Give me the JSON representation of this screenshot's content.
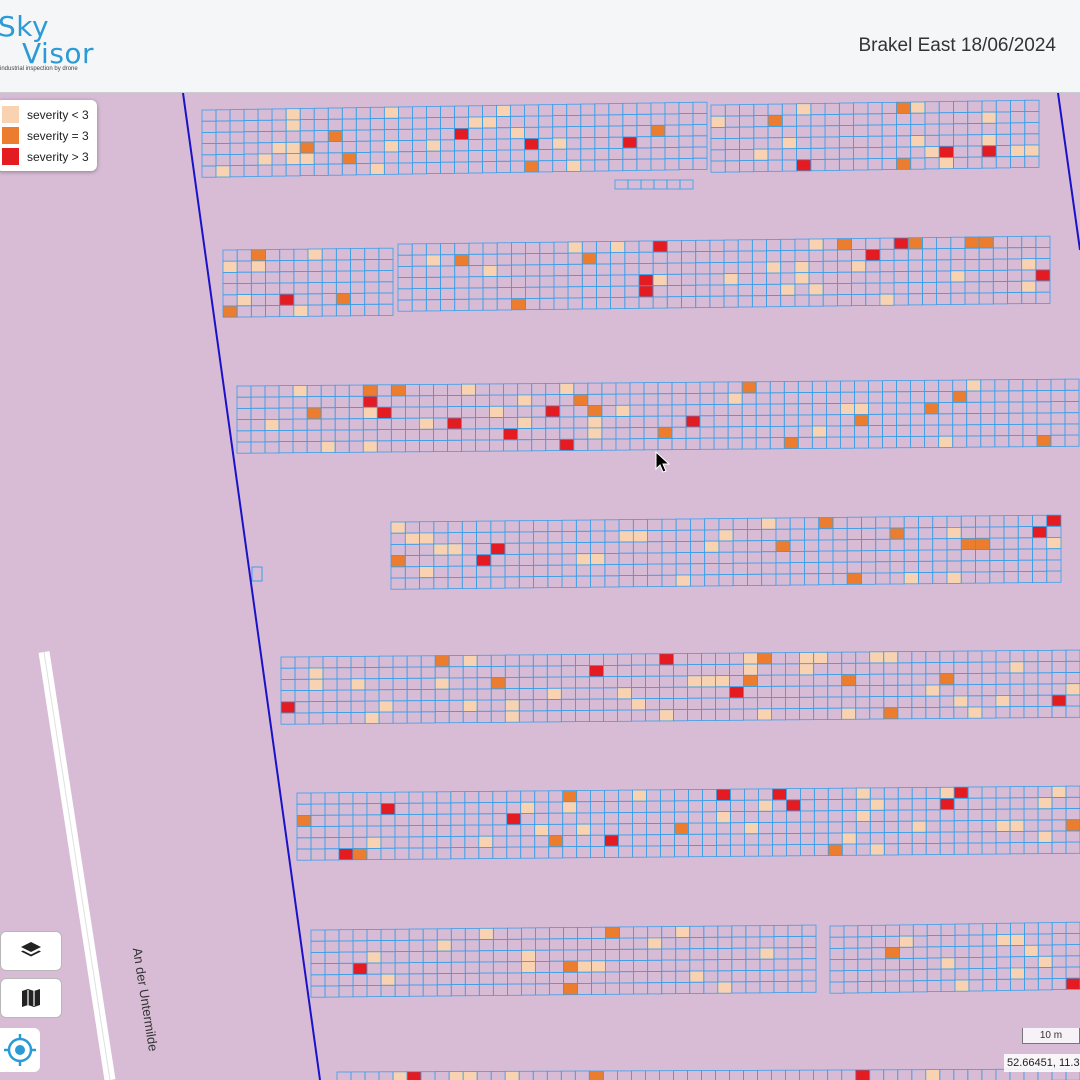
{
  "header": {
    "logo_line1": "Sky",
    "logo_line2": "Visor",
    "logo_tagline": "industrial inspection by drone",
    "title": "Brakel East 18/06/2024"
  },
  "legend": {
    "items": [
      {
        "label": "severity < 3",
        "color": "#f9d3b1"
      },
      {
        "label": "severity = 3",
        "color": "#ec7c2e"
      },
      {
        "label": "severity > 3",
        "color": "#e41c22"
      }
    ]
  },
  "map": {
    "background": "#d8bcd6",
    "panel_grid_color": "#3a9fe8",
    "boundary_color": "#1a12c8",
    "road_label": "An der Untermilde",
    "scale_label": "10 m",
    "coordinates": "52.66451, 11.3"
  },
  "controls": {
    "layers_icon": "layers-icon",
    "map_icon": "map-icon",
    "locate_icon": "crosshair-icon"
  }
}
